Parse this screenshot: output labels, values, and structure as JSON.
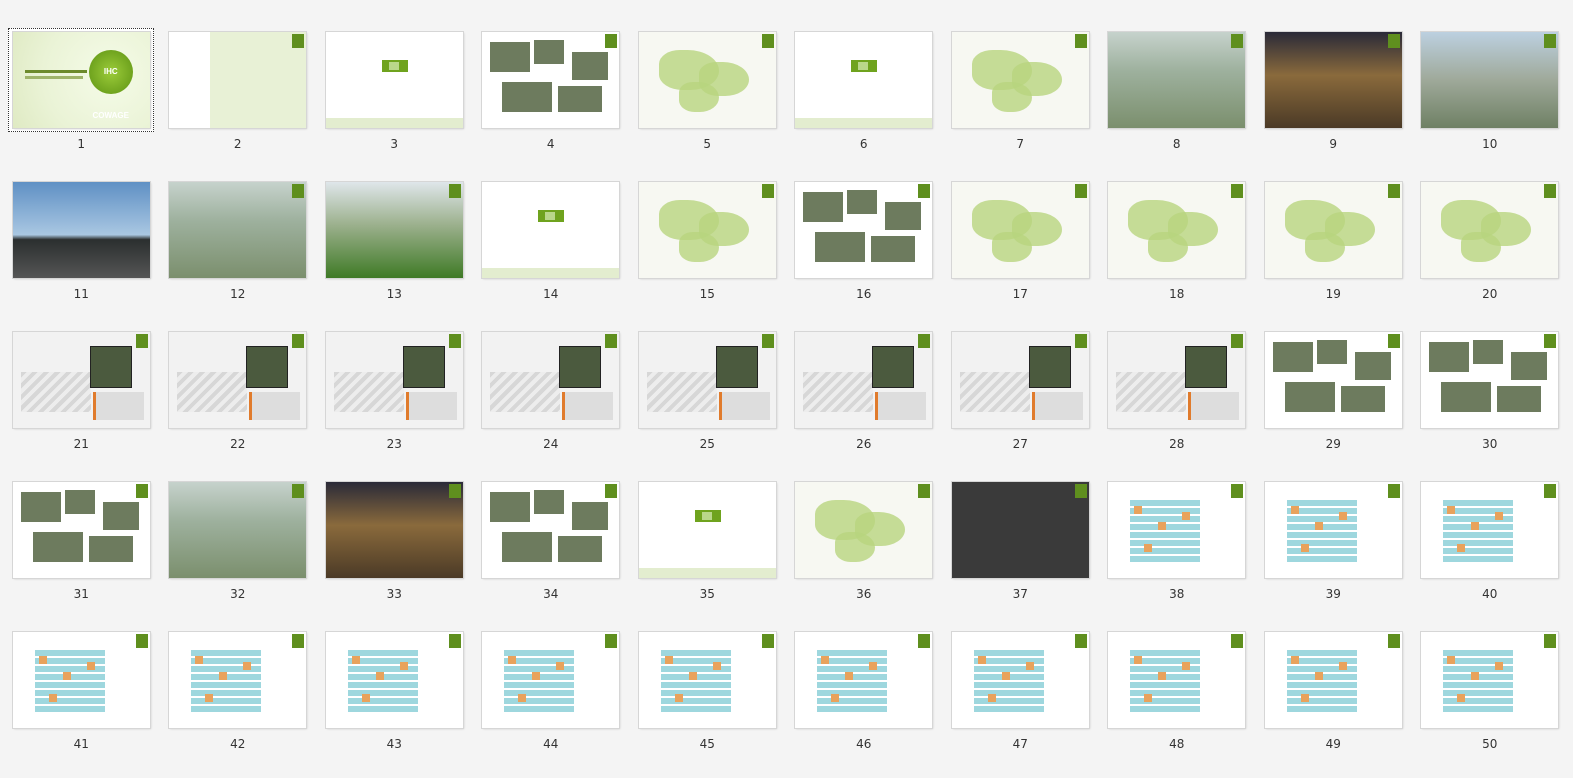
{
  "viewer": {
    "selected_index": 0,
    "slides": [
      {
        "label": "1",
        "kind": "cover",
        "logo_text": "IHC COWAGE"
      },
      {
        "label": "2",
        "kind": "toc"
      },
      {
        "label": "3",
        "kind": "section"
      },
      {
        "label": "4",
        "kind": "collage"
      },
      {
        "label": "5",
        "kind": "map"
      },
      {
        "label": "6",
        "kind": "section"
      },
      {
        "label": "7",
        "kind": "map"
      },
      {
        "label": "8",
        "kind": "aerial"
      },
      {
        "label": "9",
        "kind": "night"
      },
      {
        "label": "10",
        "kind": "city"
      },
      {
        "label": "11",
        "kind": "sky"
      },
      {
        "label": "12",
        "kind": "aerial"
      },
      {
        "label": "13",
        "kind": "lawn"
      },
      {
        "label": "14",
        "kind": "section"
      },
      {
        "label": "15",
        "kind": "map"
      },
      {
        "label": "16",
        "kind": "collage"
      },
      {
        "label": "17",
        "kind": "map"
      },
      {
        "label": "18",
        "kind": "map"
      },
      {
        "label": "19",
        "kind": "map"
      },
      {
        "label": "20",
        "kind": "map"
      },
      {
        "label": "21",
        "kind": "diagram"
      },
      {
        "label": "22",
        "kind": "diagram"
      },
      {
        "label": "23",
        "kind": "diagram"
      },
      {
        "label": "24",
        "kind": "diagram"
      },
      {
        "label": "25",
        "kind": "diagram"
      },
      {
        "label": "26",
        "kind": "diagram"
      },
      {
        "label": "27",
        "kind": "diagram"
      },
      {
        "label": "28",
        "kind": "diagram"
      },
      {
        "label": "29",
        "kind": "collage"
      },
      {
        "label": "30",
        "kind": "collage"
      },
      {
        "label": "31",
        "kind": "collage"
      },
      {
        "label": "32",
        "kind": "aerial"
      },
      {
        "label": "33",
        "kind": "night"
      },
      {
        "label": "34",
        "kind": "collage"
      },
      {
        "label": "35",
        "kind": "section"
      },
      {
        "label": "36",
        "kind": "map"
      },
      {
        "label": "37",
        "kind": "dark"
      },
      {
        "label": "38",
        "kind": "plan"
      },
      {
        "label": "39",
        "kind": "plan"
      },
      {
        "label": "40",
        "kind": "plan"
      },
      {
        "label": "41",
        "kind": "plan"
      },
      {
        "label": "42",
        "kind": "plan"
      },
      {
        "label": "43",
        "kind": "plan"
      },
      {
        "label": "44",
        "kind": "plan"
      },
      {
        "label": "45",
        "kind": "plan"
      },
      {
        "label": "46",
        "kind": "plan"
      },
      {
        "label": "47",
        "kind": "plan"
      },
      {
        "label": "48",
        "kind": "plan"
      },
      {
        "label": "49",
        "kind": "plan"
      },
      {
        "label": "50",
        "kind": "plan"
      }
    ]
  },
  "colors": {
    "accent_green": "#6fa31e",
    "selection_border": "#333333",
    "background": "#f4f4f4"
  }
}
